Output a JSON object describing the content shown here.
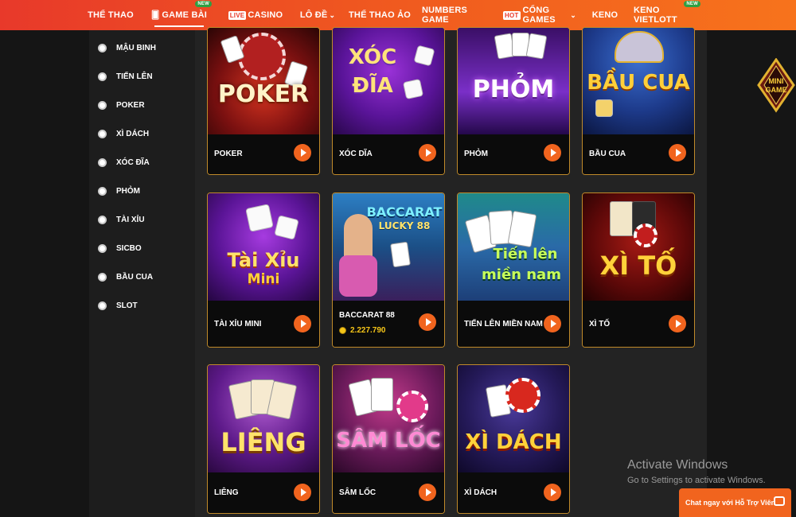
{
  "nav": {
    "items": [
      {
        "label": "THỂ THAO"
      },
      {
        "label": "GAME BÀI",
        "badge": "NEW"
      },
      {
        "label": "CASINO",
        "prefix": "LIVE"
      },
      {
        "label": "LÔ ĐỀ"
      },
      {
        "label": "THỂ THAO ẢO"
      },
      {
        "label": "NUMBERS GAME"
      },
      {
        "label": "CỔNG GAMES",
        "prefix": "HOT"
      },
      {
        "label": "KENO"
      },
      {
        "label": "KENO VIETLOTT",
        "badge": "NEW"
      }
    ],
    "active_index": 1
  },
  "sidebar": {
    "items": [
      {
        "label": "MẬU BINH"
      },
      {
        "label": "TIẾN LÊN"
      },
      {
        "label": "POKER"
      },
      {
        "label": "XÌ DÁCH"
      },
      {
        "label": "XÓC ĐĨA"
      },
      {
        "label": "PHỎM"
      },
      {
        "label": "TÀI XỈU"
      },
      {
        "label": "SICBO"
      },
      {
        "label": "BẦU CUA"
      },
      {
        "label": "SLOT"
      }
    ]
  },
  "games": [
    {
      "name": "POKER",
      "thumb_text": "POKER",
      "thumb_sub": ""
    },
    {
      "name": "XÓC DĨA",
      "thumb_text": "XÓC",
      "thumb_sub": "ĐĨA"
    },
    {
      "name": "PHỎM",
      "thumb_text": "PHỎM",
      "thumb_sub": ""
    },
    {
      "name": "BẦU CUA",
      "thumb_text": "BẦU CUA",
      "thumb_sub": ""
    },
    {
      "name": "TÀI XỈU MINI",
      "thumb_text": "Tài Xỉu",
      "thumb_sub": "Mini"
    },
    {
      "name": "BACCARAT 88",
      "thumb_text": "BACCARAT",
      "thumb_sub": "LUCKY 88",
      "jackpot": "2.227.790"
    },
    {
      "name": "TIẾN LÊN MIỀN NAM",
      "thumb_text": "Tiến lên",
      "thumb_sub": "miền nam"
    },
    {
      "name": "XÌ TỐ",
      "thumb_text": "XÌ TỐ",
      "thumb_sub": ""
    },
    {
      "name": "LIÊNG",
      "thumb_text": "LIÊNG",
      "thumb_sub": ""
    },
    {
      "name": "SÂM LỐC",
      "thumb_text": "SÂM LỐC",
      "thumb_sub": ""
    },
    {
      "name": "XÌ DÁCH",
      "thumb_text": "XÌ DÁCH",
      "thumb_sub": ""
    }
  ],
  "minigame": {
    "line1": "MINI",
    "line2": "GAME"
  },
  "windows_watermark": {
    "title": "Activate Windows",
    "subtitle": "Go to Settings to activate Windows."
  },
  "chat": {
    "label": "Chat ngay với Hỗ Trợ Viên"
  },
  "colors": {
    "accent": "#f1641e",
    "card_border": "#c08a2a",
    "nav_start": "#e8392a",
    "nav_end": "#f7731c"
  }
}
